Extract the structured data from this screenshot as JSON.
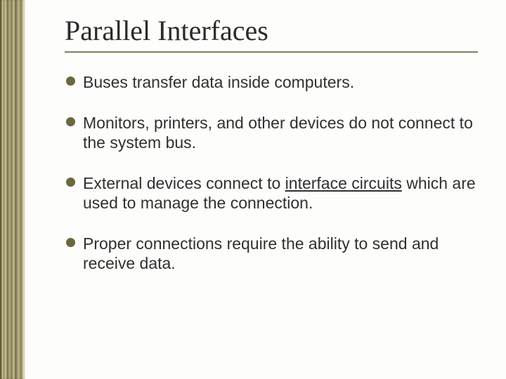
{
  "title": "Parallel Interfaces",
  "bullets": {
    "b1": "Buses transfer data inside computers.",
    "b2": "Monitors, printers, and other devices do not connect to the system bus.",
    "b3_pre": "External devices connect to ",
    "b3_u": "interface circuits",
    "b3_post": " which are used to manage the connection.",
    "b4": "Proper connections require the ability to send and receive data."
  }
}
